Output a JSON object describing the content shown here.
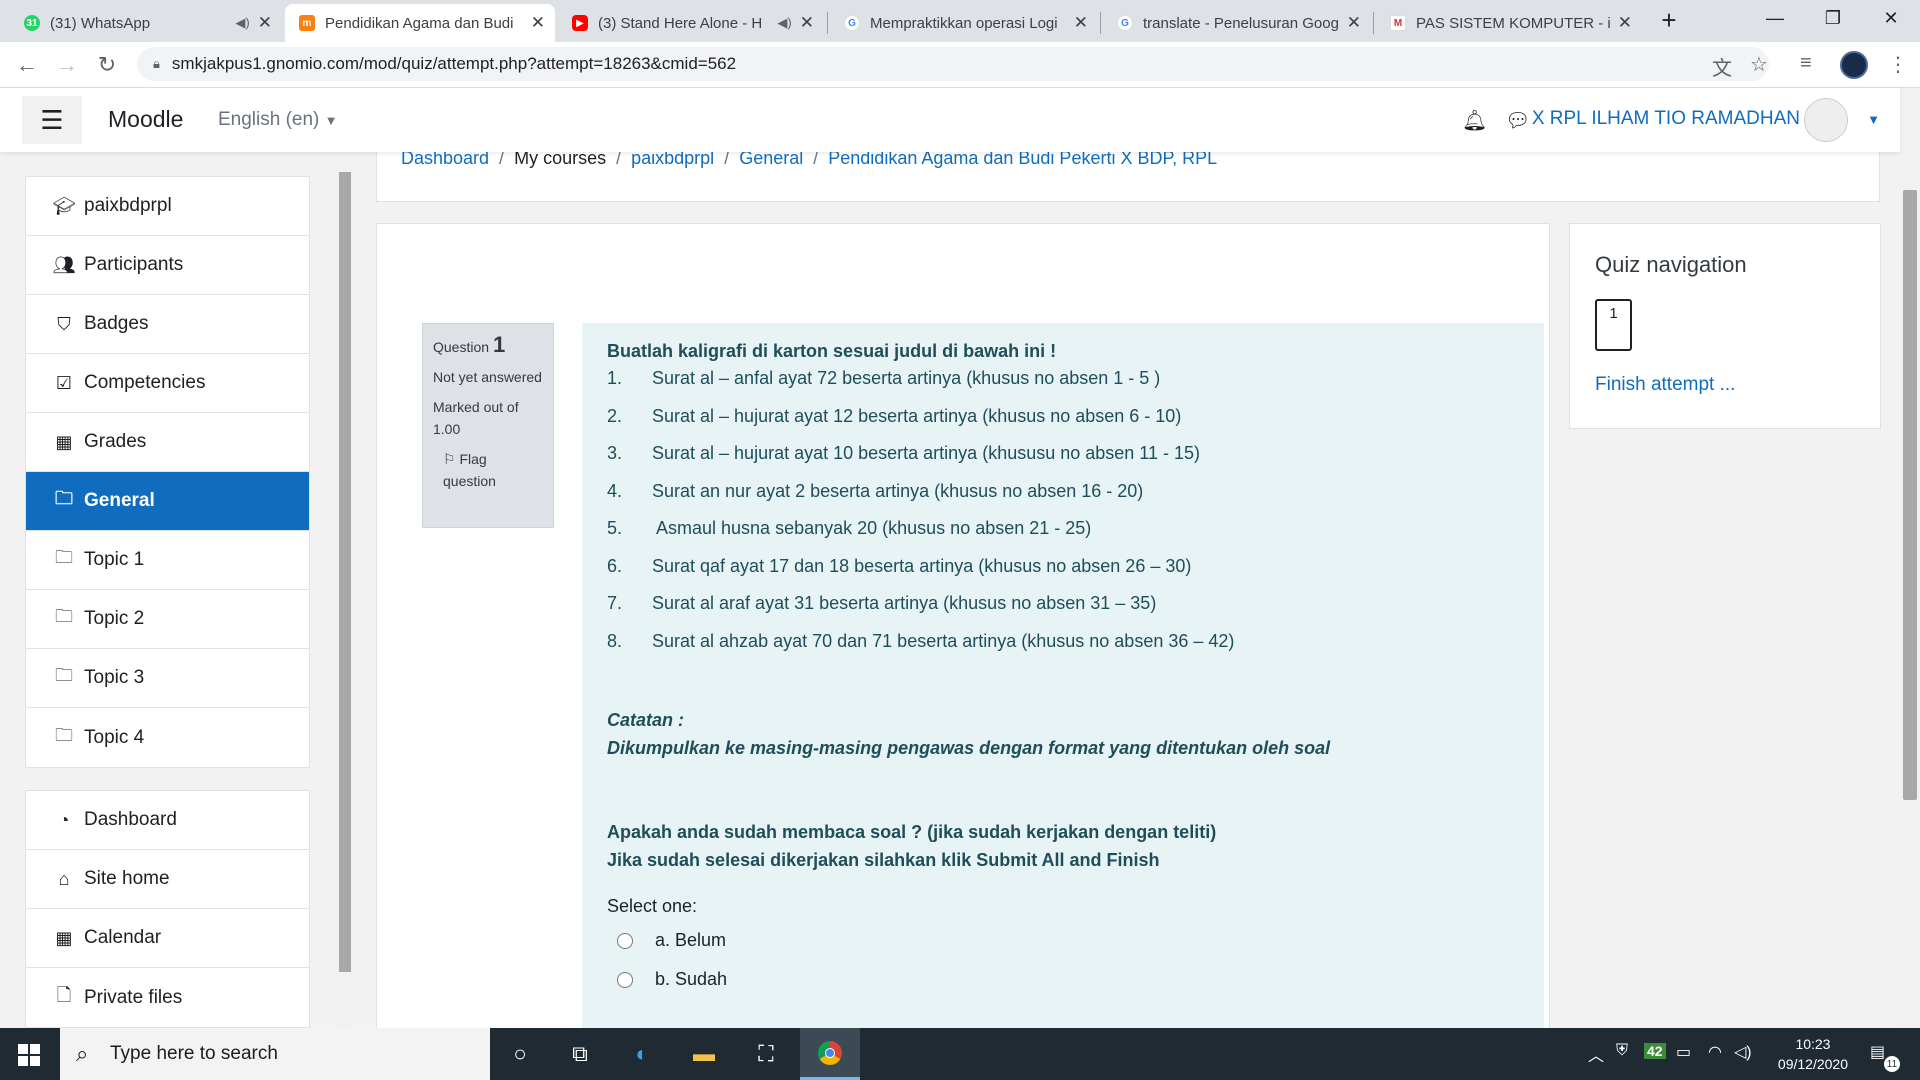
{
  "browser": {
    "tabs": [
      {
        "title": "(31) WhatsApp",
        "favicon": "whatsapp-icon",
        "audio": true
      },
      {
        "title": "Pendidikan Agama dan Budi",
        "favicon": "moodle-icon",
        "active": true
      },
      {
        "title": "(3) Stand Here Alone - H",
        "favicon": "youtube-icon",
        "audio": true
      },
      {
        "title": "Mempraktikkan operasi Logi",
        "favicon": "google-icon"
      },
      {
        "title": "translate - Penelusuran Goog",
        "favicon": "google-icon"
      },
      {
        "title": "PAS SISTEM KOMPUTER - ilh",
        "favicon": "gmail-icon"
      }
    ],
    "url": "smkjakpus1.gnomio.com/mod/quiz/attempt.php?attempt=18263&cmid=562"
  },
  "navbar": {
    "brand": "Moodle",
    "language": "English (en)",
    "user": "X RPL ILHAM TIO RAMADHAN"
  },
  "drawer": {
    "course_items": [
      {
        "label": "paixbdprpl",
        "icon": "graduation-cap-icon"
      },
      {
        "label": "Participants",
        "icon": "users-icon"
      },
      {
        "label": "Badges",
        "icon": "shield-icon"
      },
      {
        "label": "Competencies",
        "icon": "check-square-icon"
      },
      {
        "label": "Grades",
        "icon": "table-icon"
      },
      {
        "label": "General",
        "icon": "folder-icon",
        "active": true
      },
      {
        "label": "Topic 1",
        "icon": "folder-icon"
      },
      {
        "label": "Topic 2",
        "icon": "folder-icon"
      },
      {
        "label": "Topic 3",
        "icon": "folder-icon"
      },
      {
        "label": "Topic 4",
        "icon": "folder-icon"
      }
    ],
    "site_items": [
      {
        "label": "Dashboard",
        "icon": "dashboard-icon"
      },
      {
        "label": "Site home",
        "icon": "home-icon"
      },
      {
        "label": "Calendar",
        "icon": "calendar-icon"
      },
      {
        "label": "Private files",
        "icon": "file-icon"
      }
    ]
  },
  "breadcrumb": [
    "Dashboard",
    "My courses",
    "paixbdprpl",
    "General",
    "Pendidikan Agama dan Budi Pekerti X BDP, RPL"
  ],
  "question": {
    "label": "Question",
    "number": "1",
    "status": "Not yet answered",
    "marked": "Marked out of 1.00",
    "flag": "Flag question",
    "heading": "Buatlah kaligrafi di karton sesuai judul di bawah ini !",
    "items": [
      {
        "n": "1.",
        "text": "Surat al – anfal ayat 72 beserta artinya (khusus no absen 1 - 5 )"
      },
      {
        "n": "2.",
        "text": "Surat al – hujurat ayat 12 beserta artinya (khusus no absen 6 - 10)"
      },
      {
        "n": "3.",
        "text": "Surat al – hujurat ayat 10 beserta artinya (khususu no absen 11 - 15)"
      },
      {
        "n": "4.",
        "text": "Surat an nur ayat 2 beserta artinya (khusus no absen 16 - 20)"
      },
      {
        "n": "5.",
        "text": " Asmaul husna sebanyak 20 (khusus no absen 21 - 25)"
      },
      {
        "n": "6.",
        "text": "Surat qaf ayat 17 dan 18 beserta artinya (khusus no absen 26 – 30)"
      },
      {
        "n": "7.",
        "text": "Surat al araf ayat 31 beserta artinya (khusus no absen 31 – 35)"
      },
      {
        "n": "8.",
        "text": "Surat al ahzab ayat 70 dan 71 beserta artinya (khusus no absen 36 – 42)"
      }
    ],
    "note_title": "Catatan :",
    "note_text": "Dikumpulkan ke masing-masing pengawas dengan format yang ditentukan oleh soal",
    "prompt1": "Apakah anda sudah membaca soal ? (jika sudah kerjakan dengan teliti)",
    "prompt2": "Jika sudah selesai dikerjakan silahkan klik Submit All and Finish",
    "select_label": "Select one:",
    "options": [
      "a. Belum",
      "b. Sudah"
    ]
  },
  "quiz_nav": {
    "title": "Quiz navigation",
    "box": "1",
    "finish": "Finish attempt ..."
  },
  "taskbar": {
    "search_placeholder": "Type here to search",
    "time": "10:23",
    "date": "09/12/2020",
    "tray_badge": "42",
    "notif_count": "11"
  }
}
